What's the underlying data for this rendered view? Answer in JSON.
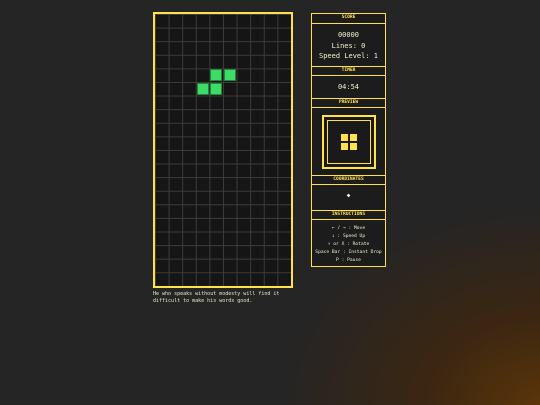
{
  "board": {
    "columns": 10,
    "rows": 20,
    "piece_color": "#3ddc68",
    "active_piece": [
      {
        "col": 4,
        "row": 4
      },
      {
        "col": 5,
        "row": 4
      },
      {
        "col": 3,
        "row": 5
      },
      {
        "col": 4,
        "row": 5
      }
    ]
  },
  "quote": "He who speaks without modesty will find it difficult to make his words good.",
  "panel": {
    "score_header": "SCORE",
    "score": "00000",
    "lines": "Lines: 0",
    "speed": "Speed Level: 1",
    "timer_header": "TIMER",
    "timer": "04:54",
    "preview_header": "PREVIEW",
    "preview_color": "#ffe14d",
    "coordinates_header": "COORDINATES",
    "coordinates_value": "◆",
    "instructions_header": "INSTRUCTIONS",
    "instructions": [
      "← / → : Move",
      "↓ : Speed Up",
      "↑ or X : Rotate",
      "Space Bar : Instant Drop",
      "P : Pause"
    ]
  },
  "accent_color": "#ffe14d"
}
